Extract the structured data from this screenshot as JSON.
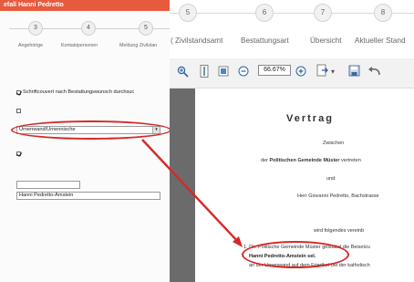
{
  "left_panel": {
    "title": "efall Hanni Pedretto",
    "steps": [
      "3",
      "4",
      "5"
    ],
    "tabs": [
      "Angehörige",
      "Kontaktpersonen",
      "Meldung Zivilstan"
    ],
    "checkbox1_label": "Schriftcouvert nach Bestattungswunsch durchsuc",
    "select_value": "Urnenwand/Urnennische",
    "select_arrow": "▾",
    "name_value": "Hanni Pedretto-Amstein"
  },
  "right_panel": {
    "steps": [
      "5",
      "6",
      "7",
      "8"
    ],
    "tabs": [
      "Zivilstandsamt",
      "Bestattungsart",
      "Übersicht",
      "Aktueller Stand"
    ],
    "tab_prefix": "(",
    "toolbar": {
      "zoom_value": "66.67%",
      "icons": [
        "zoom-in-icon",
        "fit-width-icon",
        "fit-page-icon",
        "zoom-out-icon",
        "zoom-in-small-icon",
        "export-icon",
        "dropdown-icon",
        "save-icon",
        "undo-icon"
      ]
    },
    "document": {
      "title": "Vertrag",
      "zwischen": "Zwischen",
      "party1_prefix": "der",
      "party1_bold": "Politischen Gemeinde Müster",
      "party1_suffix": "vertreten",
      "und": "und",
      "party2": "Herr Giovanni Pedretto, Bachstrasse",
      "agreement": "wird folgendes vereinb",
      "clause_line1": "1. Die Politische Gemeinde Müster gestattet die Beisetzu",
      "clause_line2": "Hanni Pedretto-Amstein sel.",
      "clause_line3": "an der Urnenwand auf dem Friedhof bei der katholisch"
    }
  },
  "colors": {
    "title_bar": "#e85a3e",
    "highlight": "#d62828"
  }
}
